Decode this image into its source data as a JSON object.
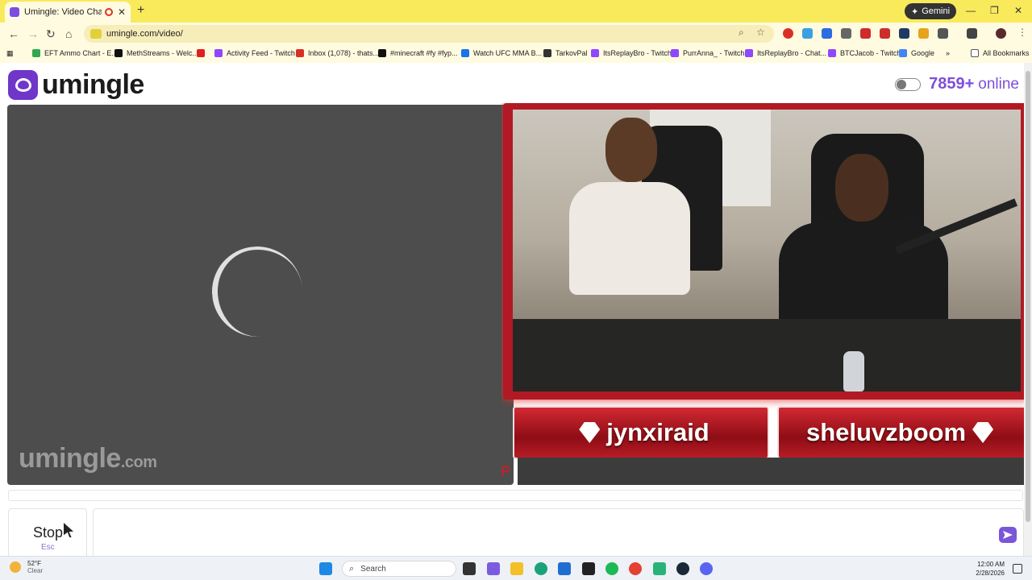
{
  "browser": {
    "tab_title": "Umingle: Video Chat with S",
    "tab_close": "✕",
    "new_tab": "+",
    "gemini_label": "Gemini",
    "window_controls": [
      "—",
      "❐",
      "✕"
    ],
    "url": "umingle.com/video/",
    "bookmarks": [
      {
        "label": "EFT Ammo Chart - E...",
        "color": "#2fa84f"
      },
      {
        "label": "MethStreams - Welc...",
        "color": "#111111"
      },
      {
        "label": "",
        "color": "#e02020"
      },
      {
        "label": "Activity Feed - Twitch",
        "color": "#9146ff"
      },
      {
        "label": "Inbox (1,078) - thats...",
        "color": "#d93025"
      },
      {
        "label": "#minecraft #fy #fyp...",
        "color": "#111111"
      },
      {
        "label": "Watch UFC MMA B...",
        "color": "#1a73e8"
      },
      {
        "label": "TarkovPal",
        "color": "#333333"
      },
      {
        "label": "ItsReplayBro - Twitch",
        "color": "#9146ff"
      },
      {
        "label": "PurrAnna_ - Twitch",
        "color": "#9146ff"
      },
      {
        "label": "ItsReplayBro - Chat...",
        "color": "#9146ff"
      },
      {
        "label": "BTCJacob - Twitch",
        "color": "#9146ff"
      },
      {
        "label": "Google",
        "color": "#4285f4"
      }
    ],
    "bookmarks_overflow": "»",
    "all_bookmarks": "All Bookmarks"
  },
  "page": {
    "logo_text": "umingle",
    "online_count": "7859+",
    "online_label": "online",
    "watermark_main": "umingle",
    "watermark_suffix": ".com",
    "watermark_mark": "P",
    "remote_names": [
      "jynxiraid",
      "sheluvzboom"
    ],
    "stop_label": "Stop",
    "stop_hint": "Esc",
    "accent_color": "#7e4ed9"
  },
  "taskbar": {
    "temperature": "52°F",
    "condition": "Clear",
    "search_placeholder": "Search",
    "time": "12:00 AM",
    "date": "2/28/2026",
    "apps": [
      "windows-start",
      "file-explorer",
      "copilot",
      "file-manager",
      "edge",
      "store",
      "terminal",
      "spotify",
      "chrome",
      "app-green",
      "steam",
      "discord"
    ]
  }
}
